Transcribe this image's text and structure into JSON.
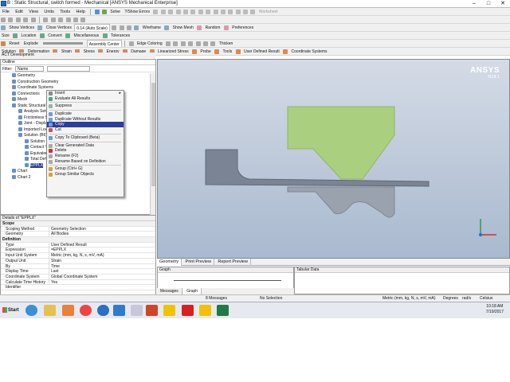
{
  "window": {
    "title": "B : Static Structural, switch formed - Mechanical [ANSYS Mechanical Enterprise]"
  },
  "menu": [
    "File",
    "Edit",
    "View",
    "Units",
    "Tools",
    "Help"
  ],
  "toolbar1": {
    "solve": "Solve",
    "show_errors": "?/Show Errors",
    "worksheet": "Worksheet"
  },
  "toolbar2": {
    "show_vertices": "Show Vertices",
    "close_vertices": "Close Vertices",
    "auto_scale": "0.14 (Auto Scale)",
    "wireframe": "Wireframe",
    "show_mesh": "Show Mesh",
    "random": "Random",
    "preferences": "Preferences"
  },
  "toolbar3": {
    "size": "Size",
    "location": "Location",
    "convert": "Convert",
    "miscellaneous": "Miscellaneous",
    "tolerances": "Tolerances"
  },
  "toolbar4": {
    "reset": "Reset",
    "explode": "Explode",
    "assembly_center": "Assembly Center",
    "edge_coloring": "Edge Coloring",
    "thicken": "Thicken"
  },
  "toolbar5": {
    "solution": "Solution",
    "deformation": "Deformation",
    "strain": "Strain",
    "stress": "Stress",
    "energy": "Energy",
    "damage": "Damage",
    "linearized_stress": "Linearized Stress",
    "probe": "Probe",
    "tools": "Tools",
    "user_defined_result": "User Defined Result",
    "coordinate_systems": "Coordinate Systems"
  },
  "act": "ACT Development",
  "outline": {
    "title": "Outline",
    "filter_label": "Filter:",
    "filter_value": "Name",
    "tree": [
      {
        "label": "Geometry",
        "indent": 1
      },
      {
        "label": "Construction Geometry",
        "indent": 1
      },
      {
        "label": "Coordinate Systems",
        "indent": 1
      },
      {
        "label": "Connections",
        "indent": 1
      },
      {
        "label": "Mesh",
        "indent": 1
      },
      {
        "label": "Static Structural (B5)",
        "indent": 1
      },
      {
        "label": "Analysis Settings",
        "indent": 2
      },
      {
        "label": "Frictionless Support",
        "indent": 2
      },
      {
        "label": "Joint - Displacement",
        "indent": 2
      },
      {
        "label": "Imported Load",
        "indent": 2
      },
      {
        "label": "Solution (B6)",
        "indent": 2
      },
      {
        "label": "Solution Information",
        "indent": 3
      },
      {
        "label": "Contact Tool",
        "indent": 3
      },
      {
        "label": "Equivalent Stress",
        "indent": 3
      },
      {
        "label": "Total Deformation",
        "indent": 3
      },
      {
        "label": "EPPLX",
        "indent": 3
      },
      {
        "label": "Chart",
        "indent": 1
      },
      {
        "label": "Chart 2",
        "indent": 1
      }
    ]
  },
  "context_menu": [
    {
      "label": "Insert",
      "sep_after": false
    },
    {
      "label": "Evaluate All Results",
      "sep_after": true
    },
    {
      "label": "Suppress",
      "sep_after": true
    },
    {
      "label": "Duplicate",
      "sep_after": false
    },
    {
      "label": "Duplicate Without Results",
      "sep_after": false
    },
    {
      "label": "Copy",
      "sep_after": false,
      "highlighted": true
    },
    {
      "label": "Cut",
      "sep_after": true
    },
    {
      "label": "Copy To Clipboard (Beta)",
      "sep_after": true
    },
    {
      "label": "Clear Generated Data",
      "sep_after": false
    },
    {
      "label": "Delete",
      "sep_after": false
    },
    {
      "label": "Rename (F2)",
      "sep_after": false
    },
    {
      "label": "Rename Based on Definition",
      "sep_after": true
    },
    {
      "label": "Group (Ctrl+ G)",
      "sep_after": false
    },
    {
      "label": "Group Similar Objects",
      "sep_after": false
    }
  ],
  "details": {
    "title": "Details of \"EPPLX\"",
    "rows": [
      {
        "key": "Scope",
        "value": "",
        "section": true
      },
      {
        "key": "Scoping Method",
        "value": "Geometry Selection"
      },
      {
        "key": "Geometry",
        "value": "All Bodies"
      },
      {
        "key": "Definition",
        "value": "",
        "section": true
      },
      {
        "key": "Type",
        "value": "User Defined Result"
      },
      {
        "key": "Expression",
        "value": "=EPPLX"
      },
      {
        "key": "Input Unit System",
        "value": "Metric (mm, kg, N, s, mV, mA)"
      },
      {
        "key": "Output Unit",
        "value": "Strain"
      },
      {
        "key": "By",
        "value": "Time"
      },
      {
        "key": "Display Time",
        "value": "Last"
      },
      {
        "key": "Coordinate System",
        "value": "Global Coordinate System"
      },
      {
        "key": "Calculate Time History",
        "value": "Yes"
      },
      {
        "key": "Identifier",
        "value": ""
      }
    ]
  },
  "viewport": {
    "brand": "ANSYS",
    "release": "R18.1"
  },
  "view_tabs": [
    "Geometry",
    "Print Preview",
    "Report Preview"
  ],
  "graph_panel": {
    "title": "Graph",
    "tabular_title": "Tabular Data"
  },
  "bottom_tabs": [
    "Messages",
    "Graph"
  ],
  "status": {
    "messages": "8 Messages",
    "selection": "No Selection",
    "units": "Metric (mm, kg, N, s, mV, mA)",
    "degrees": "Degrees",
    "rads": "rad/s",
    "celsius": "Celsius"
  },
  "taskbar": {
    "start": "Start",
    "time": "10:18 AM",
    "date": "7/19/2017"
  }
}
